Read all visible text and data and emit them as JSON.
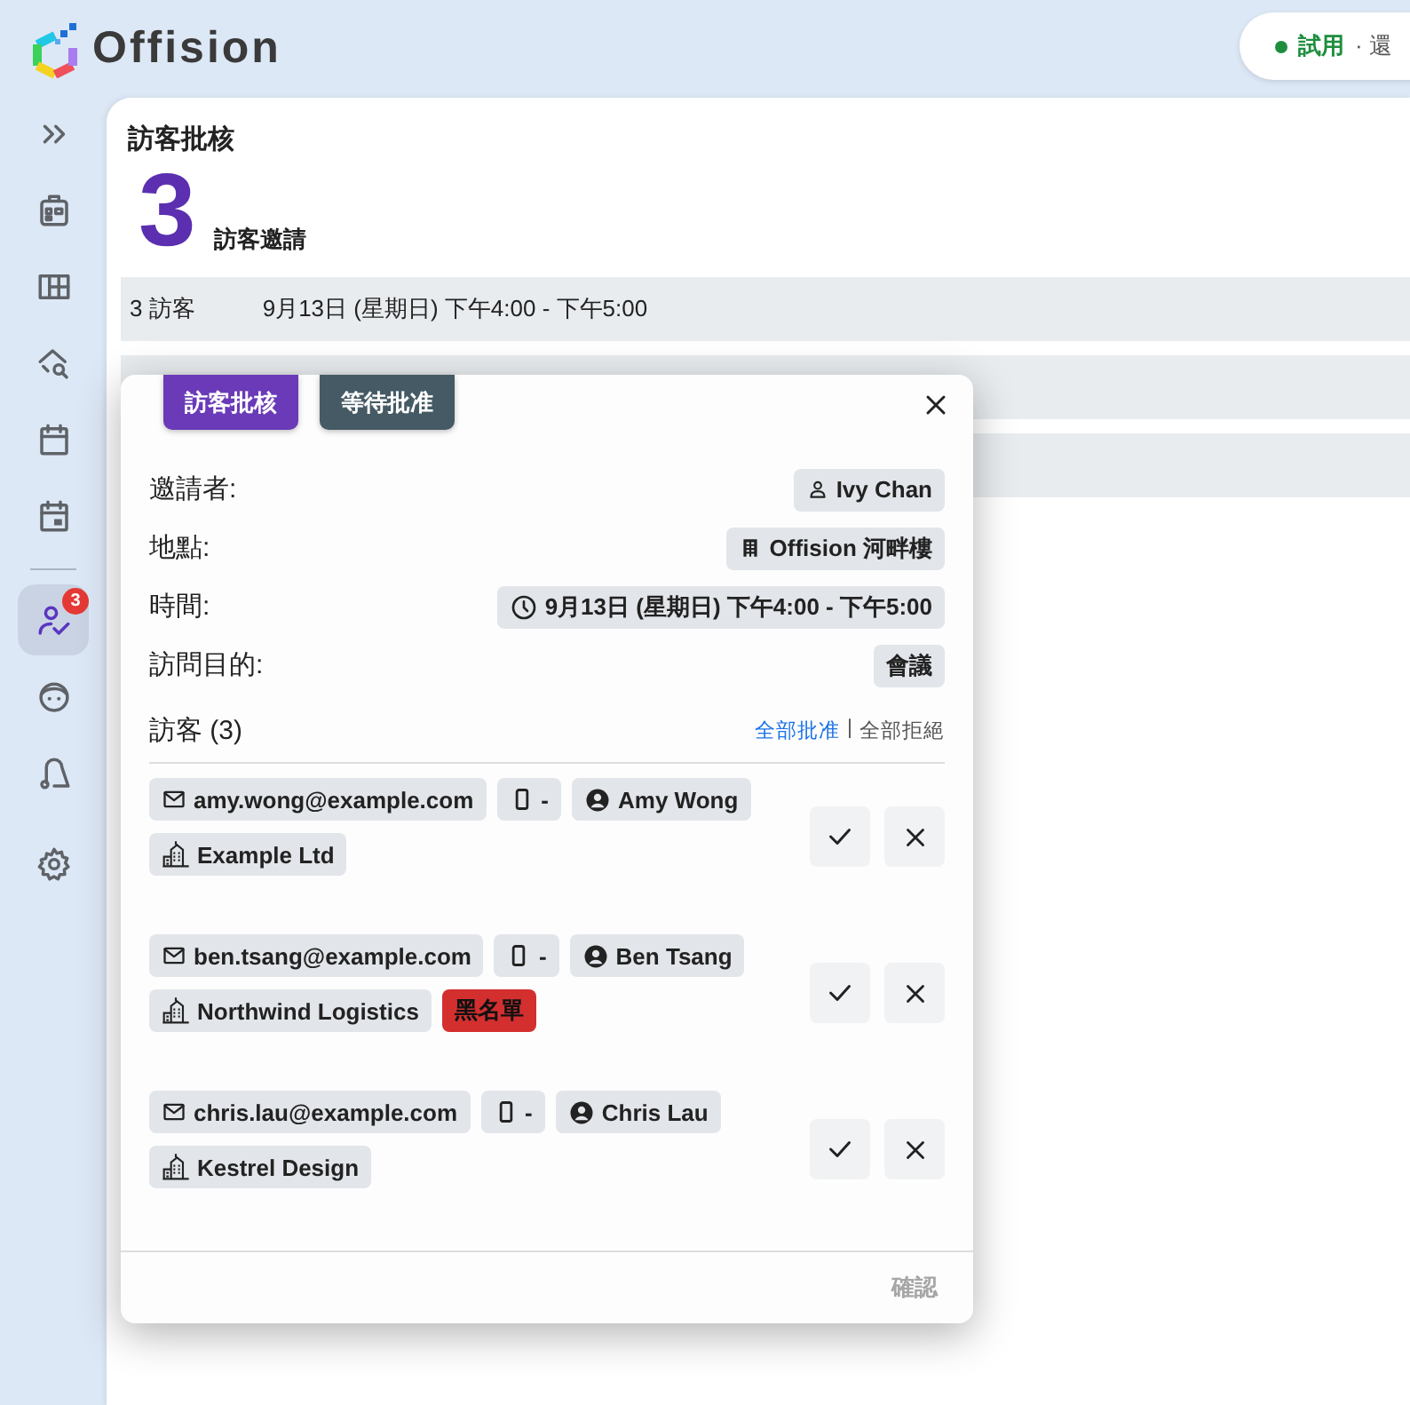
{
  "header": {
    "logo": "Offision",
    "trial": {
      "label": "試用",
      "rest": "· 還"
    }
  },
  "sidebar": {
    "groups": [
      [
        {
          "kind": "expand",
          "selected": false
        },
        {
          "kind": "building",
          "selected": false
        },
        {
          "kind": "grid",
          "selected": false
        },
        {
          "kind": "search",
          "selected": false
        },
        {
          "kind": "calendar",
          "selected": false
        },
        {
          "kind": "event",
          "selected": false
        }
      ],
      [
        {
          "kind": "visitors",
          "selected": true,
          "badge": "3"
        },
        {
          "kind": "support",
          "selected": false
        },
        {
          "kind": "cleaning",
          "selected": false
        },
        {
          "kind": "settings",
          "selected": false
        }
      ]
    ]
  },
  "page": {
    "title": "訪客批核",
    "count": "3",
    "count_label": "訪客邀請",
    "rows": [
      {
        "kind": "summary",
        "visitors": "3 訪客",
        "time": "9月13日 (星期日) 下午4:00 - 下午5:00"
      },
      {
        "kind": "blank"
      },
      {
        "kind": "blank"
      }
    ]
  },
  "modal": {
    "status_chips": [
      {
        "label": "訪客批核",
        "kind": "primary"
      },
      {
        "label": "等待批准",
        "kind": "dark"
      }
    ],
    "details": [
      {
        "label": "邀請者:",
        "value": "Ivy Chan",
        "kind": "person"
      },
      {
        "label": "地點:",
        "value": "Offision 河畔樓",
        "kind": "building"
      },
      {
        "label": "時間:",
        "value": "9月13日 (星期日) 下午4:00 - 下午5:00",
        "kind": "time"
      },
      {
        "label": "訪問目的:",
        "value": "會議",
        "kind": "plain"
      }
    ],
    "visitors": {
      "title": "訪客 (3)",
      "approve_all": "全部批准",
      "separator": "|",
      "reject_all": "全部拒絕",
      "list": [
        {
          "email": "amy.wong@example.com",
          "phone": "-",
          "name": "Amy Wong",
          "company": "Example Ltd"
        },
        {
          "email": "ben.tsang@example.com",
          "phone": "-",
          "name": "Ben Tsang",
          "company": "Northwind Logistics",
          "blacklist_label": "黑名單"
        },
        {
          "email": "chris.lau@example.com",
          "phone": "-",
          "name": "Chris Lau",
          "company": "Kestrel Design"
        }
      ]
    },
    "confirm": {
      "label": "確認",
      "disabled": true
    }
  }
}
